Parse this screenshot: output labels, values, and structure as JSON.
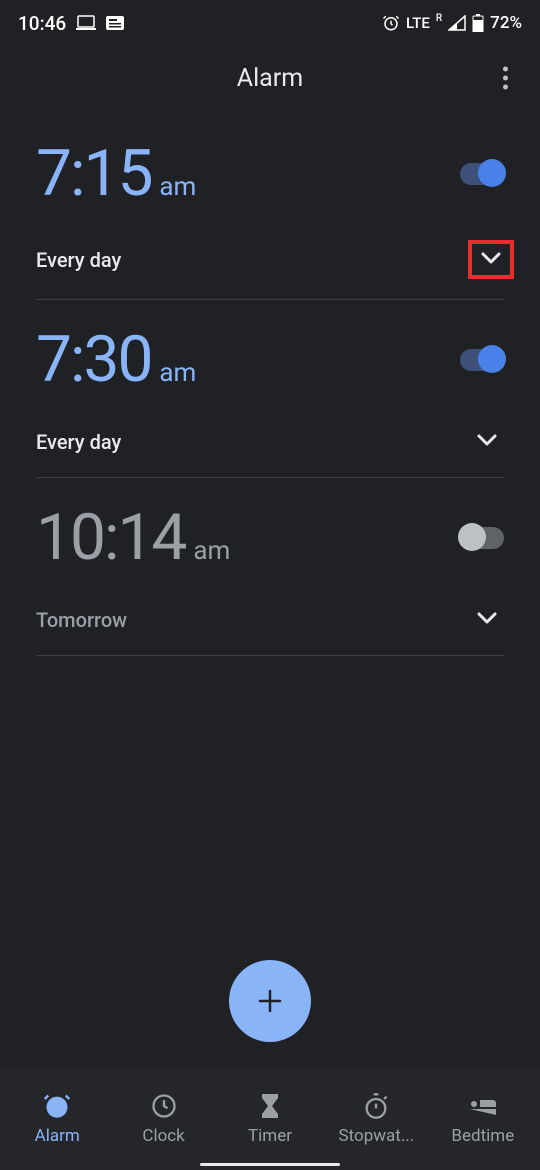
{
  "status": {
    "time": "10:46",
    "network": "LTE",
    "roaming": "R",
    "battery": "72%"
  },
  "header": {
    "title": "Alarm"
  },
  "alarms": [
    {
      "time": "7:15",
      "ampm": "am",
      "repeat": "Every day",
      "enabled": true,
      "highlight_expand": true
    },
    {
      "time": "7:30",
      "ampm": "am",
      "repeat": "Every day",
      "enabled": true,
      "highlight_expand": false
    },
    {
      "time": "10:14",
      "ampm": "am",
      "repeat": "Tomorrow",
      "enabled": false,
      "highlight_expand": false
    }
  ],
  "nav": {
    "items": [
      {
        "label": "Alarm",
        "active": true
      },
      {
        "label": "Clock",
        "active": false
      },
      {
        "label": "Timer",
        "active": false
      },
      {
        "label": "Stopwat...",
        "active": false
      },
      {
        "label": "Bedtime",
        "active": false
      }
    ]
  },
  "colors": {
    "accent": "#8ab4f8",
    "background": "#1f2125",
    "highlight": "#e52e2e"
  }
}
